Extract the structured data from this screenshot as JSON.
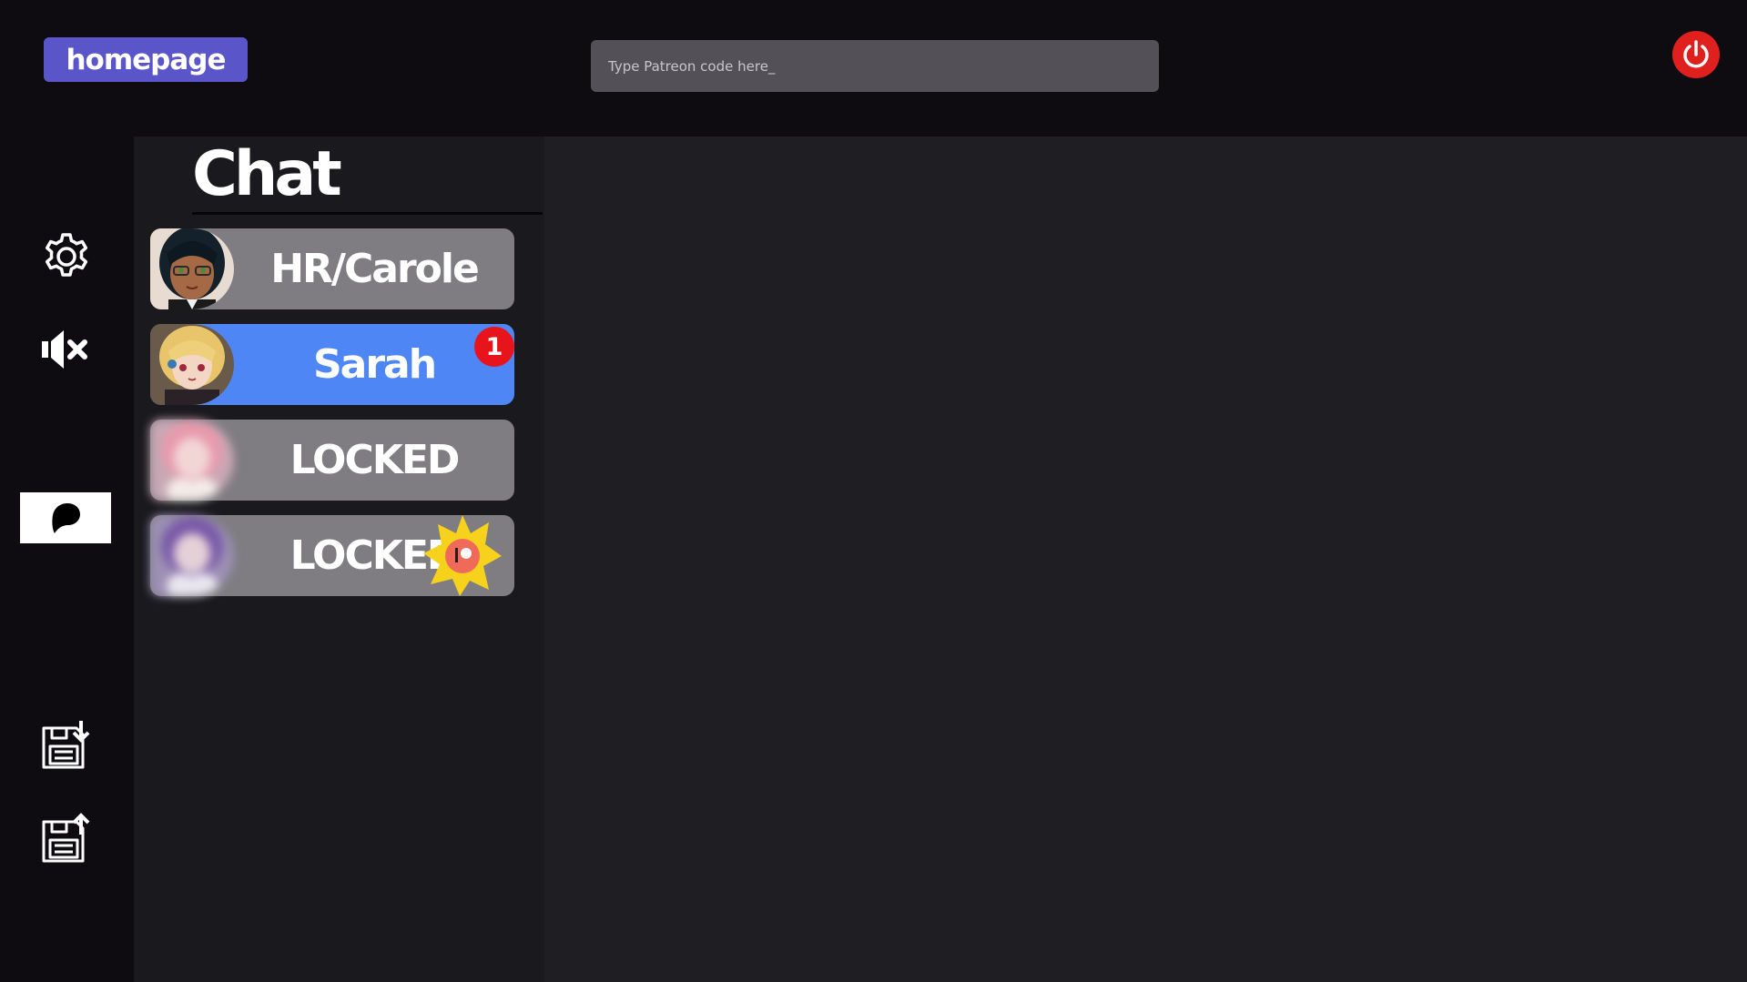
{
  "header": {
    "home_label": "homepage",
    "code_placeholder": "Type Patreon code here_",
    "code_value": ""
  },
  "rail": {
    "settings_icon": "gear-icon",
    "sound_icon": "speaker-muted-icon",
    "patreon_icon": "patreon-icon",
    "save_icon": "save-download-icon",
    "load_icon": "save-upload-icon"
  },
  "chat": {
    "title": "Chat",
    "contacts": [
      {
        "name": "HR/Carole",
        "active": false,
        "locked": false
      },
      {
        "name": "Sarah",
        "active": true,
        "locked": false,
        "unread": "1"
      },
      {
        "name": "LOCKED",
        "active": false,
        "locked": true
      },
      {
        "name": "LOCKED",
        "active": false,
        "locked": true,
        "patreon_star": true
      }
    ]
  },
  "colors": {
    "home_button": "#5a55c8",
    "active_contact": "#4e87f5",
    "contact": "#7f7d82",
    "badge": "#e8141b",
    "power": "#e0201e"
  }
}
